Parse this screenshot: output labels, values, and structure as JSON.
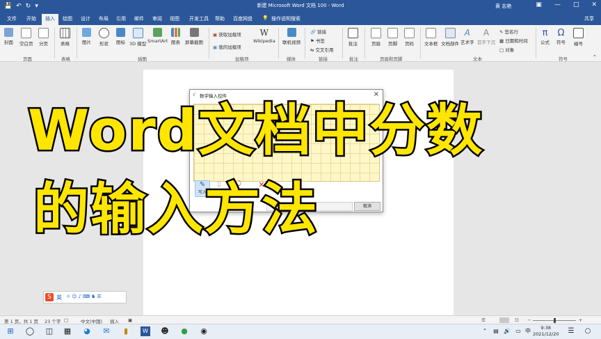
{
  "window": {
    "title": "新建 Microsoft Word 文档 100 - Word",
    "user": "黄 志艳",
    "share": "共享"
  },
  "quick_access": {
    "icons": [
      "save-icon",
      "undo-icon",
      "redo-icon",
      "customize-icon"
    ]
  },
  "tabs": [
    "文件",
    "开始",
    "插入",
    "绘图",
    "设计",
    "布局",
    "引用",
    "邮件",
    "审阅",
    "视图",
    "开发工具",
    "帮助",
    "百度网盘",
    "操作说明搜索"
  ],
  "ribbon": {
    "pages": {
      "cover": "封面",
      "blank": "空白页",
      "break": "分页",
      "group": "页面"
    },
    "tables": {
      "table": "表格",
      "group": "表格"
    },
    "illustrations": {
      "pictures": "图片",
      "shapes": "形状",
      "icons": "图标",
      "model3d": "3D 模型",
      "smartart": "SmartArt",
      "chart": "图表",
      "screenshot": "屏幕截图",
      "group": "插图"
    },
    "addins": {
      "get": "获取加载项",
      "my": "我的加载项",
      "wikipedia": "Wikipedia",
      "group": "加载项"
    },
    "media": {
      "video": "联机视频",
      "group": "媒体"
    },
    "links": {
      "link": "链接",
      "bookmark": "书签",
      "crossref": "交叉引用",
      "group": "链接"
    },
    "comments": {
      "comment": "批注",
      "group": "批注"
    },
    "header_footer": {
      "header": "页眉",
      "footer": "页脚",
      "page_number": "页码",
      "group": "页眉和页脚"
    },
    "text": {
      "textbox": "文本框",
      "quickparts": "文档部件",
      "wordart": "艺术字",
      "dropcap": "首字下沉",
      "signature": "签名行",
      "datetime": "日期和时间",
      "object": "对象",
      "group": "文本"
    },
    "symbols": {
      "equation": "公式",
      "symbol": "符号",
      "number": "编号",
      "group": "符号"
    }
  },
  "dialog": {
    "title": "数学输入控件",
    "write_label": "写入",
    "erase_label": "擦除",
    "cancel_label": "取消"
  },
  "overlay": {
    "line1": "Word文档中分数",
    "line2": "的输入方法"
  },
  "ime": {
    "lang": "英"
  },
  "statusbar": {
    "page": "第 1 页，共 1 页",
    "words": "23 个字",
    "language": "中文(中国)",
    "mode": "插入"
  },
  "taskbar": {
    "time": "9:38",
    "date": "2021/12/20"
  },
  "colors": {
    "word_blue": "#2b579a",
    "overlay_yellow": "#ffe600",
    "ime_orange": "#ea4d26"
  }
}
